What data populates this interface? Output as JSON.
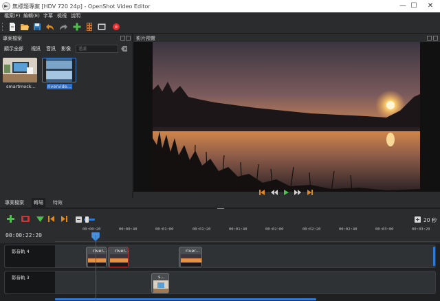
{
  "window": {
    "title": "無標題專案 [HDV 720 24p] - OpenShot Video Editor",
    "controls": {
      "minimize": "—",
      "maximize": "☐",
      "close": "✕"
    }
  },
  "menu": [
    "檔案(F)",
    "編輯(E)",
    "字幕",
    "檢視",
    "說明"
  ],
  "toolbar": {
    "icons": [
      "new-project-icon",
      "open-project-icon",
      "save-project-icon",
      "undo-icon",
      "redo-icon",
      "import-files-icon",
      "profile-icon",
      "fullscreen-icon",
      "export-icon"
    ]
  },
  "files_panel": {
    "title": "專案檔案",
    "filters": [
      "顯示全部",
      "視訊",
      "音訊",
      "影像"
    ],
    "search_placeholder": "過濾",
    "files": [
      {
        "label": "smartmock...",
        "selected": false
      },
      {
        "label": "rivervide...",
        "selected": true
      }
    ]
  },
  "preview_panel": {
    "title": "影片預覽"
  },
  "bottom_tabs": [
    "專案檔案",
    "轉場",
    "特效"
  ],
  "timeline": {
    "zoom_label": "20 秒",
    "current_time": "00:00:22:20",
    "ticks": [
      "00:00:20",
      "00:00:40",
      "00:01:00",
      "00:01:20",
      "00:01:40",
      "00:02:00",
      "00:02:20",
      "00:02:40",
      "00:03:00",
      "00:03:20"
    ],
    "tracks": [
      {
        "name": "影音軌 4",
        "clips": [
          {
            "label": "river..."
          },
          {
            "label": "river..."
          },
          {
            "label": "river..."
          }
        ]
      },
      {
        "name": "影音軌 3",
        "clips": [
          {
            "label": "s..."
          }
        ]
      }
    ]
  },
  "colors": {
    "accent": "#2f7ad6",
    "playhead": "#cc2a2a",
    "clip_border": "#6d7174"
  }
}
